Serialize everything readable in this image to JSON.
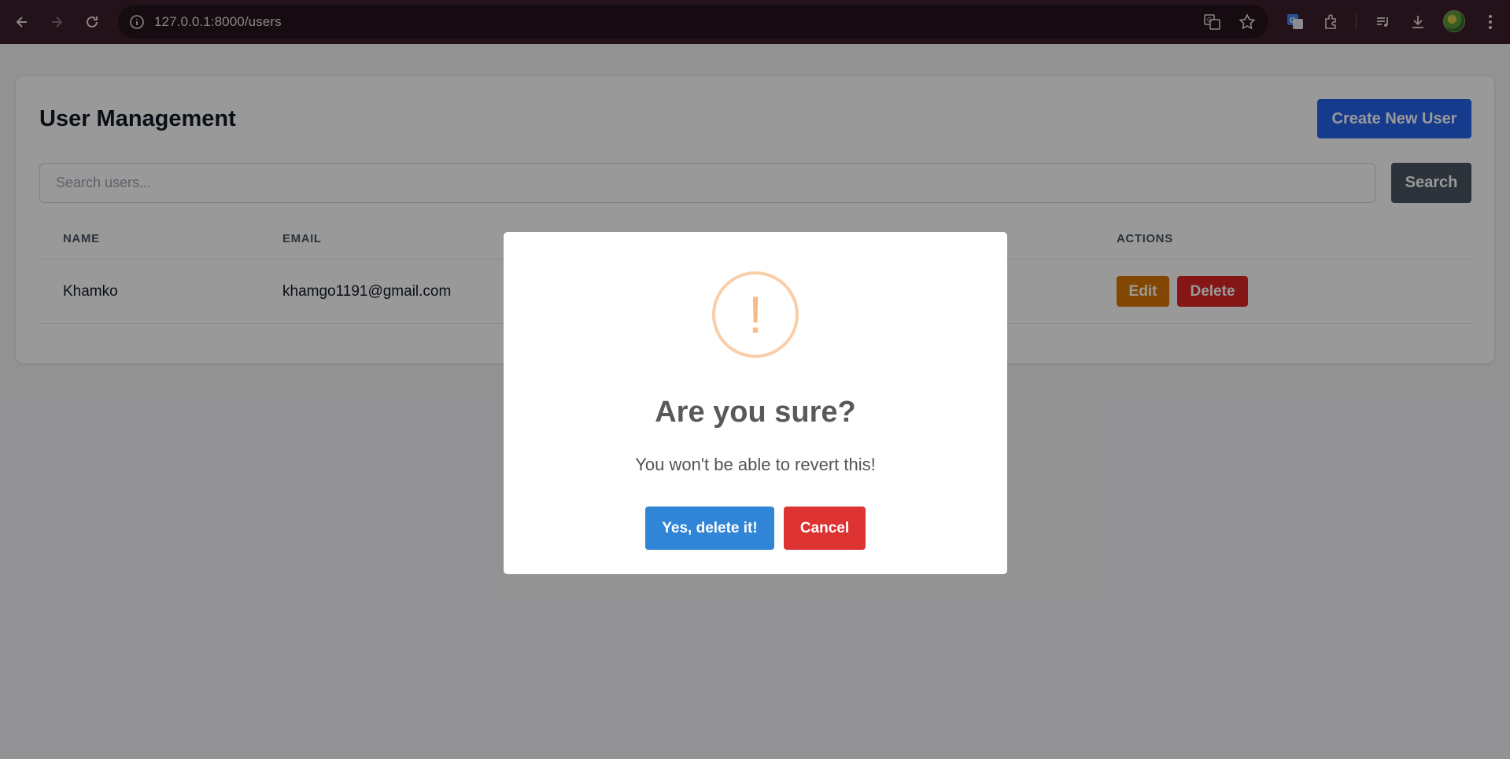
{
  "browser": {
    "url": "127.0.0.1:8000/users"
  },
  "page": {
    "title": "User Management",
    "create_button": "Create New User",
    "search": {
      "placeholder": "Search users...",
      "button": "Search"
    },
    "table": {
      "headers": [
        "NAME",
        "EMAIL",
        "ACTIONS"
      ],
      "rows": [
        {
          "name": "Khamko",
          "email": "khamgo1191@gmail.com",
          "edit": "Edit",
          "delete": "Delete"
        }
      ]
    }
  },
  "modal": {
    "icon": "!",
    "title": "Are you sure?",
    "text": "You won't be able to revert this!",
    "confirm": "Yes, delete it!",
    "cancel": "Cancel"
  },
  "colors": {
    "primary": "#2563eb",
    "edit": "#d97706",
    "delete": "#dc2626",
    "confirm": "#3085d6",
    "cancel": "#dd3333",
    "warning": "#f8bb86"
  }
}
